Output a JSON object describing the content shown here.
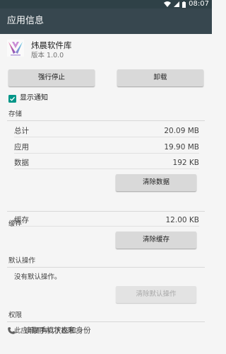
{
  "status_bar": {
    "time": "08:07",
    "icons": [
      "wifi-icon",
      "signal-icon",
      "battery-icon"
    ]
  },
  "app_bar": {
    "title": "应用信息"
  },
  "app": {
    "name": "炜晨软件库",
    "version": "版本 1.0.0",
    "icon": "app-logo-icon"
  },
  "actions": {
    "force_stop": "强行停止",
    "uninstall": "卸载"
  },
  "notifications": {
    "label": "显示通知",
    "checked": true
  },
  "storage": {
    "title": "存储",
    "rows": [
      {
        "label": "总计",
        "value": "20.09 MB"
      },
      {
        "label": "应用",
        "value": "19.90 MB"
      },
      {
        "label": "数据",
        "value": "192 KB"
      }
    ],
    "clear_data": "清除数据"
  },
  "cache": {
    "title": "缓存",
    "label": "缓存",
    "value": "12.00 KB",
    "clear_cache": "清除缓存"
  },
  "defaults": {
    "title": "默认操作",
    "text": "没有默认操作。",
    "clear_defaults": "清除默认操作"
  },
  "permissions": {
    "title": "权限",
    "intro": "此应用拥有以下权限：",
    "items": [
      {
        "label": "读取手机状态和身份",
        "icon": "phone-icon"
      }
    ]
  },
  "colors": {
    "status_bar": "#2f4147",
    "app_bar": "#37474f",
    "accent": "#009688"
  }
}
